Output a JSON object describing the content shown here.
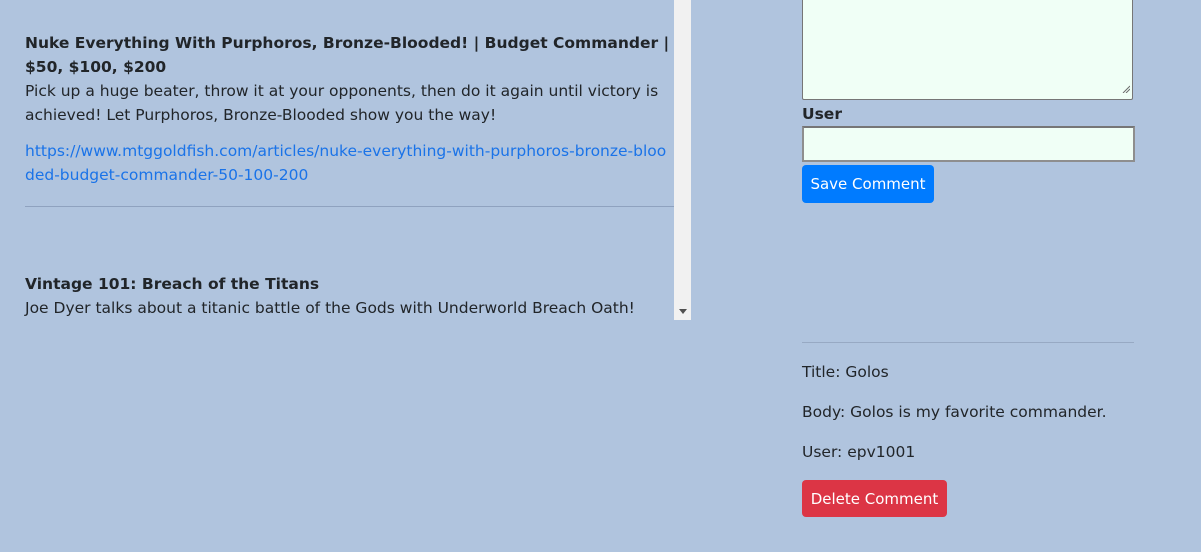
{
  "articles": [
    {
      "title": "Nuke Everything With Purphoros, Bronze-Blooded! | Budget Commander | $50, $100, $200",
      "description": "Pick up a huge beater, throw it at your opponents, then do it again until victory is achieved! Let Purphoros, Bronze-Blooded show you the way!",
      "link": "https://www.mtggoldfish.com/articles/nuke-everything-with-purphoros-bronze-blooded-budget-commander-50-100-200"
    },
    {
      "title": "Vintage 101: Breach of the Titans",
      "description": "Joe Dyer talks about a titanic battle of the Gods with Underworld Breach Oath!"
    }
  ],
  "comment_form": {
    "body_value": "",
    "user_label": "User",
    "user_value": "",
    "save_label": "Save Comment"
  },
  "comment": {
    "title_line": "Title: Golos",
    "body_line": "Body: Golos is my favorite commander.",
    "user_line": "User: epv1001",
    "delete_label": "Delete Comment"
  },
  "icons": {
    "scroll_down": "chevron-down-icon",
    "resize": "resize-grip-icon"
  },
  "colors": {
    "background": "#b0c4de",
    "link": "#1a73e8",
    "save_button": "#007bff",
    "delete_button": "#dc3545",
    "input_background": "#f0fff6"
  }
}
